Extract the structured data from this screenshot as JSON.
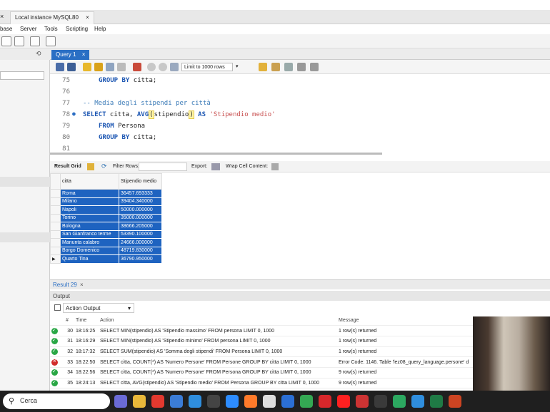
{
  "app": {
    "tabs": [
      {
        "label": "Local instance MySQL80",
        "close": "×"
      }
    ],
    "left_close": "×"
  },
  "menu": [
    "base",
    "Server",
    "Tools",
    "Scripting",
    "Help"
  ],
  "query_tab": {
    "label": "Query 1",
    "close": "×"
  },
  "limit_select": "Limit to 1000 rows",
  "editor": {
    "lines": [
      {
        "n": "75",
        "marker": ""
      },
      {
        "n": "76",
        "marker": ""
      },
      {
        "n": "77",
        "marker": ""
      },
      {
        "n": "78",
        "marker": "●"
      },
      {
        "n": "79",
        "marker": ""
      },
      {
        "n": "80",
        "marker": ""
      },
      {
        "n": "81",
        "marker": ""
      }
    ],
    "code": {
      "l75": [
        "GROUP BY",
        " citta;"
      ],
      "l77": "-- Media degli stipendi per città",
      "l78": [
        "SELECT",
        " citta, ",
        "AVG",
        "(",
        "stipendio",
        ")",
        " AS ",
        "'Stipendio medio'"
      ],
      "l79": [
        "FROM",
        " Persona"
      ],
      "l80": [
        "GROUP BY",
        " citta;"
      ]
    }
  },
  "result_toolbar": {
    "result_grid": "Result Grid",
    "filter_rows": "Filter Rows:",
    "export": "Export:",
    "wrap": "Wrap Cell Content:"
  },
  "grid": {
    "headers": [
      "citta",
      "Stipendio medio"
    ],
    "rows": [
      [
        "Roma",
        "36457.693333"
      ],
      [
        "Milano",
        "39404.340000"
      ],
      [
        "Napoli",
        "50000.000000"
      ],
      [
        "Torino",
        "35000.000000"
      ],
      [
        "Bologna",
        "38666.205000"
      ],
      [
        "San Gianfranco terme",
        "53390.100000"
      ],
      [
        "Manunta calabro",
        "24666.000000"
      ],
      [
        "Borgo Domenico",
        "48719.830000"
      ],
      [
        "Quarto Tina",
        "36790.950000"
      ]
    ]
  },
  "result_tab": {
    "label": "Result 29",
    "close": "×"
  },
  "output": {
    "header": "Output",
    "selector": "Action Output",
    "columns": [
      "#",
      "Time",
      "Action",
      "Message"
    ],
    "rows": [
      {
        "status": "ok",
        "num": "30",
        "time": "18:16:25",
        "action": "SELECT MIN(stipendio) AS 'Stipendio massimo' FROM persona LIMIT 0, 1000",
        "message": "1 row(s) returned"
      },
      {
        "status": "ok",
        "num": "31",
        "time": "18:16:29",
        "action": "SELECT MIN(stipendio) AS 'Stipendio minimo' FROM persona LIMIT 0, 1000",
        "message": "1 row(s) returned"
      },
      {
        "status": "ok",
        "num": "32",
        "time": "18:17:32",
        "action": "SELECT SUM(stipendio) AS 'Somma degli stipendi' FROM Persona LIMIT 0, 1000",
        "message": "1 row(s) returned"
      },
      {
        "status": "err",
        "num": "33",
        "time": "18:22:50",
        "action": "SELECT citta, COUNT(*) AS 'Numero Persone'  FROM Persone    GROUP BY citta LIMIT 0, 1000",
        "message": "Error Code: 1146. Table 'lez08_query_language.persone' d"
      },
      {
        "status": "ok",
        "num": "34",
        "time": "18:22:56",
        "action": "SELECT citta, COUNT(*) AS 'Numero Persone'  FROM Persona    GROUP BY citta LIMIT 0, 1000",
        "message": "9 row(s) returned"
      },
      {
        "status": "ok",
        "num": "35",
        "time": "18:24:13",
        "action": "SELECT citta, AVG(stipendio) AS 'Stipendio medio' FROM Persona     GROUP BY citta LIMIT 0, 1000",
        "message": "9 row(s) returned"
      }
    ]
  },
  "taskbar": {
    "search_placeholder": "Cerca",
    "apps": [
      "windows-search",
      "file-explorer",
      "text-app",
      "teams",
      "trello",
      "typora",
      "chrome-profile",
      "firefox",
      "unity",
      "photoshop",
      "chrome",
      "opera",
      "youtube",
      "video-app",
      "wacom",
      "camtasia",
      "vscode",
      "excel",
      "media"
    ],
    "colors": [
      "#6b6bd6",
      "#e9b83a",
      "#e2392f",
      "#3b7cd6",
      "#2f8ede",
      "#444444",
      "#2d8cff",
      "#ff7a2a",
      "#dddddd",
      "#2b6fd4",
      "#34a853",
      "#d8272b",
      "#ff2020",
      "#cc3333",
      "#3a3a3a",
      "#2ca860",
      "#2f8ede",
      "#1f7a45",
      "#cc4422"
    ]
  },
  "colors": {
    "selection": "#1e63c0",
    "query_tab": "#2a6fc4",
    "keyword": "#1d57b3",
    "string": "#c84f4f",
    "comment": "#3a7ab7"
  }
}
